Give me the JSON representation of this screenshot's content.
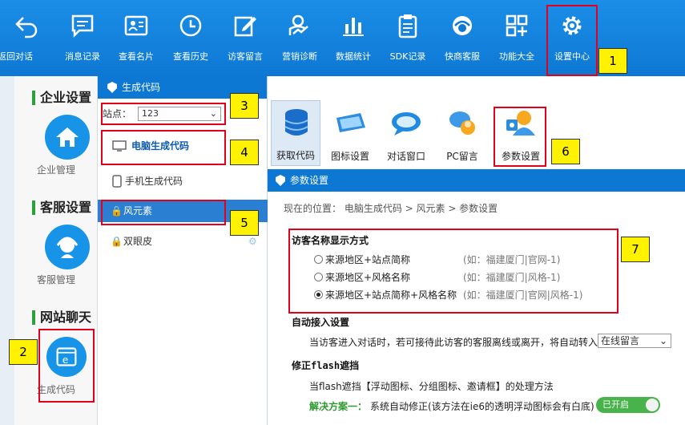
{
  "toolbar": {
    "items": [
      {
        "label": "返回对话",
        "icon": "return-arrow-icon"
      },
      {
        "label": "消息记录",
        "icon": "message-icon"
      },
      {
        "label": "查看名片",
        "icon": "card-icon"
      },
      {
        "label": "查看历史",
        "icon": "clock-icon"
      },
      {
        "label": "访客留言",
        "icon": "edit-icon"
      },
      {
        "label": "营销诊断",
        "icon": "diagnosis-icon"
      },
      {
        "label": "数据统计",
        "icon": "bar-chart-icon"
      },
      {
        "label": "SDK记录",
        "icon": "clipboard-icon"
      },
      {
        "label": "快商客服",
        "icon": "headset-icon"
      },
      {
        "label": "功能大全",
        "icon": "grid-plus-icon"
      },
      {
        "label": "设置中心",
        "icon": "gear-icon"
      }
    ]
  },
  "markers": [
    "1",
    "2",
    "3",
    "4",
    "5",
    "6",
    "7"
  ],
  "sidebar": {
    "sections": [
      {
        "title": "企业设置",
        "item": "企业管理",
        "icon": "home-icon"
      },
      {
        "title": "客服设置",
        "item": "客服管理",
        "icon": "agent-icon"
      },
      {
        "title": "网站聊天",
        "item": "生成代码",
        "icon": "browser-e-icon"
      }
    ]
  },
  "code_panel": {
    "title": "生成代码",
    "station_label": "站点：",
    "station_value": "123",
    "items": [
      {
        "label": "电脑生成代码",
        "icon": "monitor-icon"
      },
      {
        "label": "手机生成代码",
        "icon": "phone-icon"
      },
      {
        "label": "风元素",
        "icon": "lock-icon"
      },
      {
        "label": "双眼皮",
        "icon": "lock-icon"
      }
    ]
  },
  "tabs": [
    {
      "label": "获取代码",
      "icon": "database-icon"
    },
    {
      "label": "图标设置",
      "icon": "icon-settings-icon"
    },
    {
      "label": "对话窗口",
      "icon": "chat-bubble-icon"
    },
    {
      "label": "PC留言",
      "icon": "pc-message-icon"
    },
    {
      "label": "参数设置",
      "icon": "param-settings-icon"
    }
  ],
  "settings": {
    "title": "参数设置",
    "breadcrumb": "现在的位置： 电脑生成代码 > 风元素 > 参数设置",
    "visitor_name": {
      "title": "访客名称显示方式",
      "options": [
        {
          "label": "来源地区+站点简称",
          "example": "(如：福建厦门|官网-1)",
          "selected": false
        },
        {
          "label": "来源地区+风格名称",
          "example": "(如：福建厦门|风格-1)",
          "selected": false
        },
        {
          "label": "来源地区+站点简称+风格名称",
          "example": "(如：福建厦门|官网|风格-1)",
          "selected": true
        }
      ]
    },
    "auto_access": {
      "title": "自动接入设置",
      "text": "当访客进入对话时，若可接待此访客的客服离线或离开，将自动转入",
      "select_value": "在线留言"
    },
    "flash": {
      "title": "修正flash遮挡",
      "text": "当flash遮挡【浮动图标、分组图标、邀请框】的处理方法",
      "solution_label": "解决方案一：",
      "solution_text": "系统自动修正(该方法在ie6的透明浮动图标会有白底)",
      "toggle_label": "已开启"
    }
  },
  "colors": {
    "toolbar": "#0d78d3",
    "highlight": "#e2001a",
    "marker": "#fff200",
    "section_bar": "#2aa23a",
    "toggle": "#47b34a"
  }
}
